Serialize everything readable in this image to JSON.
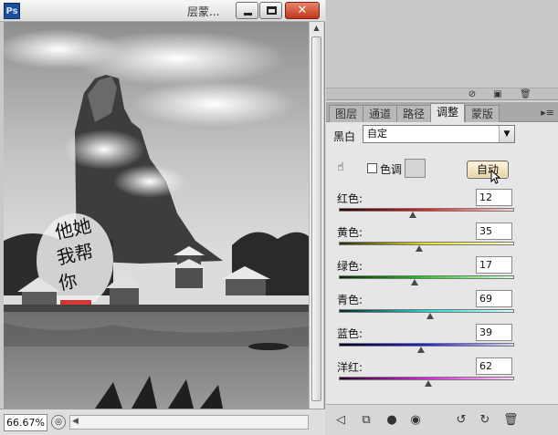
{
  "document": {
    "title": "层蒙...",
    "zoom": "66.67%",
    "calligraphy": "他她我帮你"
  },
  "right_panel": {
    "tabs": [
      {
        "label": "图层",
        "active": false
      },
      {
        "label": "通道",
        "active": false
      },
      {
        "label": "路径",
        "active": false
      },
      {
        "label": "调整",
        "active": true
      },
      {
        "label": "蒙版",
        "active": false
      }
    ]
  },
  "adjustment": {
    "preset_label": "黑白",
    "preset_value": "自定",
    "tint_label": "色调",
    "tint_checked": false,
    "auto_label": "自动",
    "sliders": [
      {
        "label": "红色:",
        "value": "12",
        "fraction": 0.42,
        "gradient": [
          "#2b0000",
          "#e82020",
          "#ffd6d6"
        ]
      },
      {
        "label": "黄色:",
        "value": "35",
        "fraction": 0.46,
        "gradient": [
          "#2b2b00",
          "#e8e020",
          "#ffffd0"
        ]
      },
      {
        "label": "绿色:",
        "value": "17",
        "fraction": 0.43,
        "gradient": [
          "#002b00",
          "#22d022",
          "#d6ffd6"
        ]
      },
      {
        "label": "青色:",
        "value": "69",
        "fraction": 0.52,
        "gradient": [
          "#002b2b",
          "#20d8d8",
          "#d6ffff"
        ]
      },
      {
        "label": "蓝色:",
        "value": "39",
        "fraction": 0.47,
        "gradient": [
          "#00002b",
          "#2020e8",
          "#d6d6ff"
        ]
      },
      {
        "label": "洋红:",
        "value": "62",
        "fraction": 0.51,
        "gradient": [
          "#2b002b",
          "#e020e0",
          "#ffd6ff"
        ]
      }
    ]
  }
}
